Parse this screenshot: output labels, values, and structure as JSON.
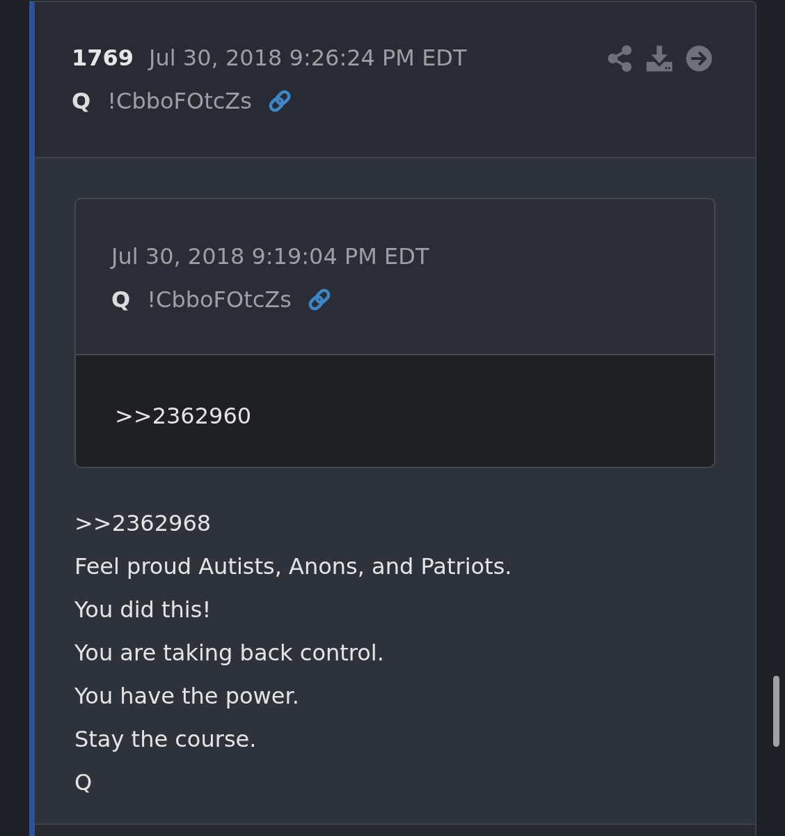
{
  "post": {
    "number": "1769",
    "date": "Jul 30, 2018 9:26:24 PM EDT",
    "author": "Q",
    "tripcode": "!CbboFOtcZs"
  },
  "quote": {
    "date": "Jul 30, 2018 9:19:04 PM EDT",
    "author": "Q",
    "tripcode": "!CbboFOtcZs",
    "text": ">>2362960"
  },
  "body": [
    ">>2362968",
    "Feel proud Autists, Anons, and Patriots.",
    "You did this!",
    "You are taking back control.",
    "You have the power.",
    "Stay the course.",
    "Q"
  ]
}
